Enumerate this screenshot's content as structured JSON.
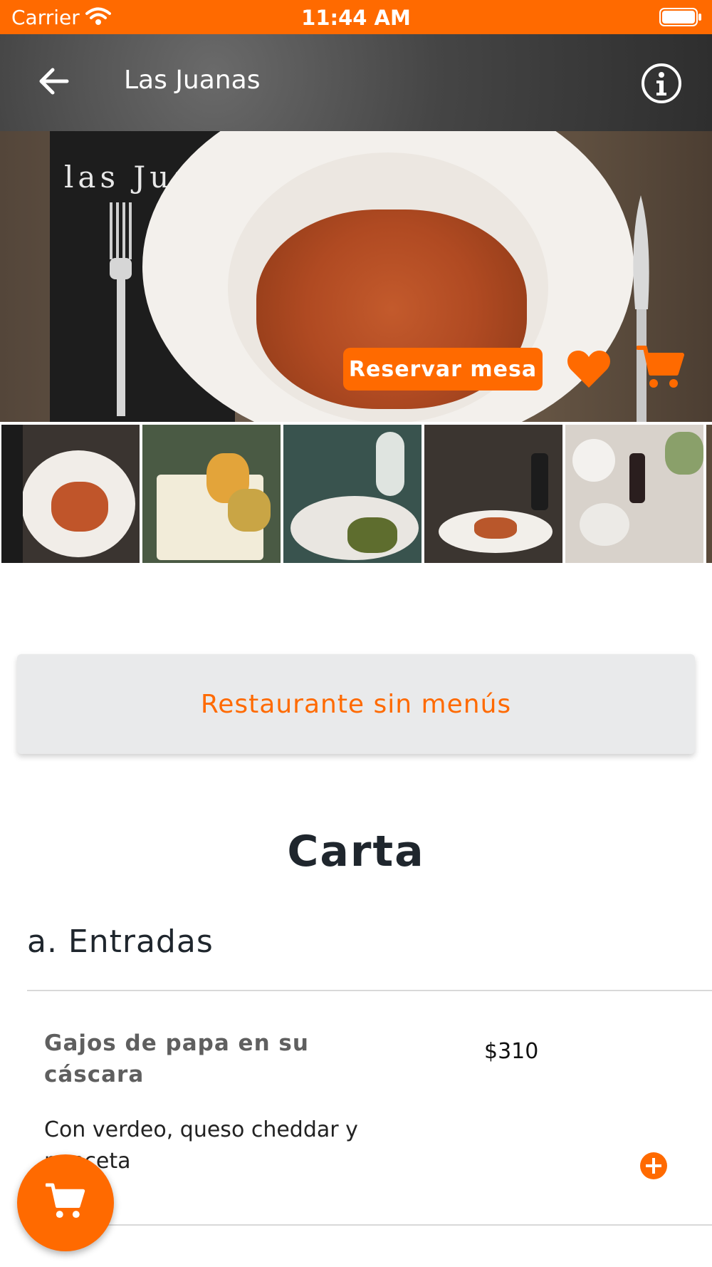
{
  "status_bar": {
    "carrier": "Carrier",
    "time": "11:44 AM"
  },
  "header": {
    "title": "Las Juanas",
    "back_icon": "arrow-left-icon",
    "info_icon": "info-circle-icon"
  },
  "hero": {
    "napkin_text": "las Juan",
    "reserve_button": "Reservar mesa",
    "favorite_icon": "heart-icon",
    "cart_icon": "cart-icon"
  },
  "gallery": {
    "thumbnail_count_visible": 5
  },
  "menus_notice": "Restaurante sin menús",
  "carta": {
    "title": "Carta",
    "section_title": "a. Entradas",
    "items": [
      {
        "name": "Gajos de papa en su cáscara",
        "price": "$310",
        "description": "Con verdeo, queso cheddar y panceta"
      }
    ]
  },
  "floating_cart_icon": "cart-icon",
  "colors": {
    "accent": "#ff6a00",
    "text_dark": "#1f262d",
    "notice_bg": "#e9eaeb"
  }
}
